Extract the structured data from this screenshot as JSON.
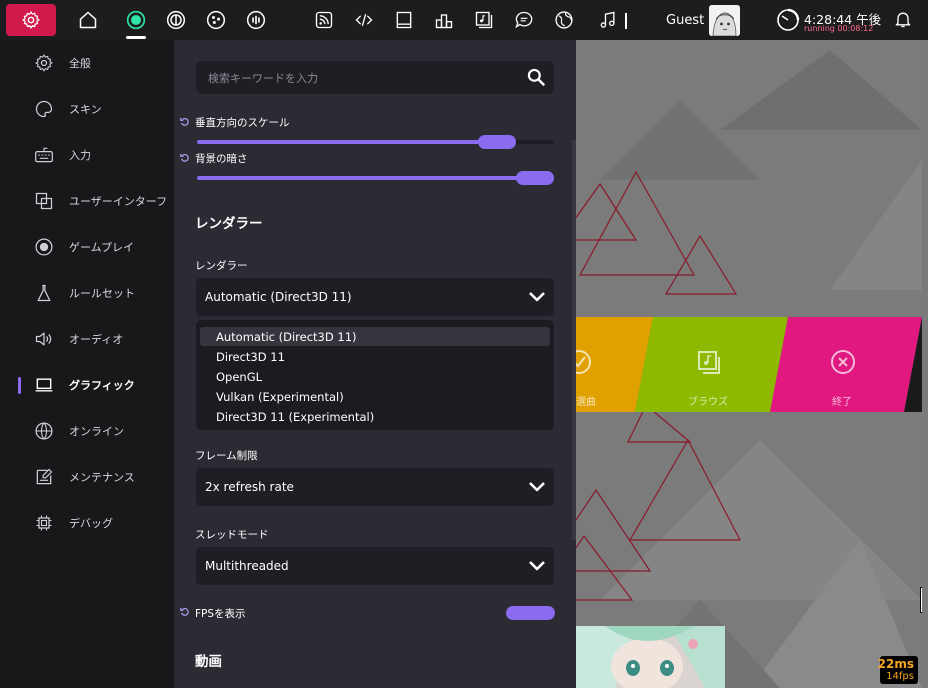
{
  "toolbar": {
    "guest_name": "Guest",
    "clock_time": "4:28:44 午後",
    "clock_running": "running 00:08:12",
    "icons": [
      "gear-icon",
      "home-icon",
      "osu-ruleset-icon",
      "taiko-ruleset-icon",
      "catch-ruleset-icon",
      "mania-ruleset-icon",
      "news-icon",
      "changelog-icon",
      "wiki-icon",
      "rankings-icon",
      "beatmap-listing-icon",
      "chat-icon",
      "world-icon",
      "music-icon",
      "user-avatar",
      "clock-icon",
      "bell-icon"
    ]
  },
  "sidebar": {
    "items": [
      {
        "label": "全般",
        "icon": "gear-icon"
      },
      {
        "label": "スキン",
        "icon": "palette-icon"
      },
      {
        "label": "入力",
        "icon": "keyboard-icon"
      },
      {
        "label": "ユーザーインターフ",
        "icon": "window-stack-icon"
      },
      {
        "label": "ゲームプレイ",
        "icon": "target-icon"
      },
      {
        "label": "ルールセット",
        "icon": "flask-icon"
      },
      {
        "label": "オーディオ",
        "icon": "speaker-icon"
      },
      {
        "label": "グラフィック",
        "icon": "laptop-icon",
        "active": true
      },
      {
        "label": "オンライン",
        "icon": "globe-icon"
      },
      {
        "label": "メンテナンス",
        "icon": "maintenance-icon"
      },
      {
        "label": "デバッグ",
        "icon": "chip-icon"
      }
    ]
  },
  "panel": {
    "search_placeholder": "検索キーワードを入力",
    "slider_vertical_scale": {
      "label": "垂直方向のスケール",
      "value_fraction": 0.88
    },
    "slider_background_dim": {
      "label": "背景の暗さ",
      "value_fraction": 1.0
    },
    "renderer_section_title": "レンダラー",
    "renderer_label": "レンダラー",
    "renderer_value": "Automatic (Direct3D 11)",
    "renderer_options": [
      "Automatic (Direct3D 11)",
      "Direct3D 11",
      "OpenGL",
      "Vulkan (Experimental)",
      "Direct3D 11 (Experimental)"
    ],
    "frame_limit_label": "フレーム制限",
    "frame_limit_value": "2x refresh rate",
    "thread_mode_label": "スレッドモード",
    "thread_mode_value": "Multithreaded",
    "show_fps_label": "FPSを表示",
    "show_fps_on": true,
    "video_section_title": "動画"
  },
  "scene": {
    "menu_labels": [
      "選曲",
      "ブラウズ",
      "終了"
    ],
    "menu_colors": [
      "#e0a100",
      "#8dba00",
      "#e0187f"
    ],
    "fps_ms": "22ms",
    "fps_fps": "14fps"
  },
  "colors": {
    "accent": "#8b6cf1",
    "settings_button": "#d2194b",
    "panel_bg": "#2c2b33",
    "sidebar_bg": "#18181b"
  }
}
